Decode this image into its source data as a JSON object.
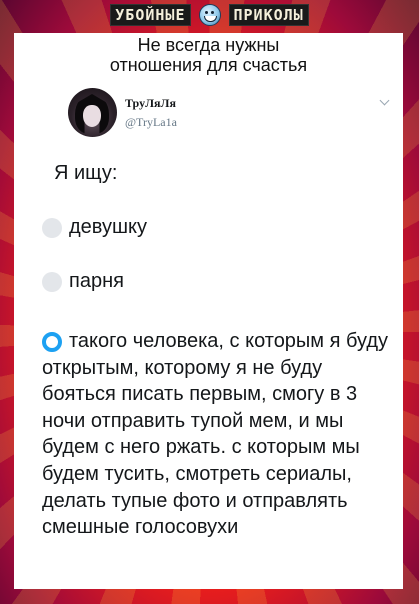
{
  "brand": {
    "left_word": "УБОЙНЫЕ",
    "right_word": "ПРИКОЛЫ",
    "icon": "laughing-face-icon"
  },
  "caption": {
    "line1": "Не всегда нужны",
    "line2": "отношения для счастья"
  },
  "tweet": {
    "display_name": "ТруЛяЛя",
    "handle": "@TryLa1a",
    "text": "Я ищу:",
    "options": [
      {
        "label": "девушку",
        "selected": false
      },
      {
        "label": "парня",
        "selected": false
      },
      {
        "label": "такого человека, с которым я буду открытым, которому я не буду бояться писать первым, смогу в 3 ночи отправить тупой мем, и мы будем с него ржать. с которым мы будем тусить, смотреть сериалы, делать тупые фото и отправлять смешные голосовухи",
        "selected": true
      }
    ]
  },
  "colors": {
    "accent": "#1da1f2",
    "frame_orange": "#ff5a14",
    "frame_red": "#e61d1d",
    "text": "#14171a",
    "muted": "#657786"
  }
}
